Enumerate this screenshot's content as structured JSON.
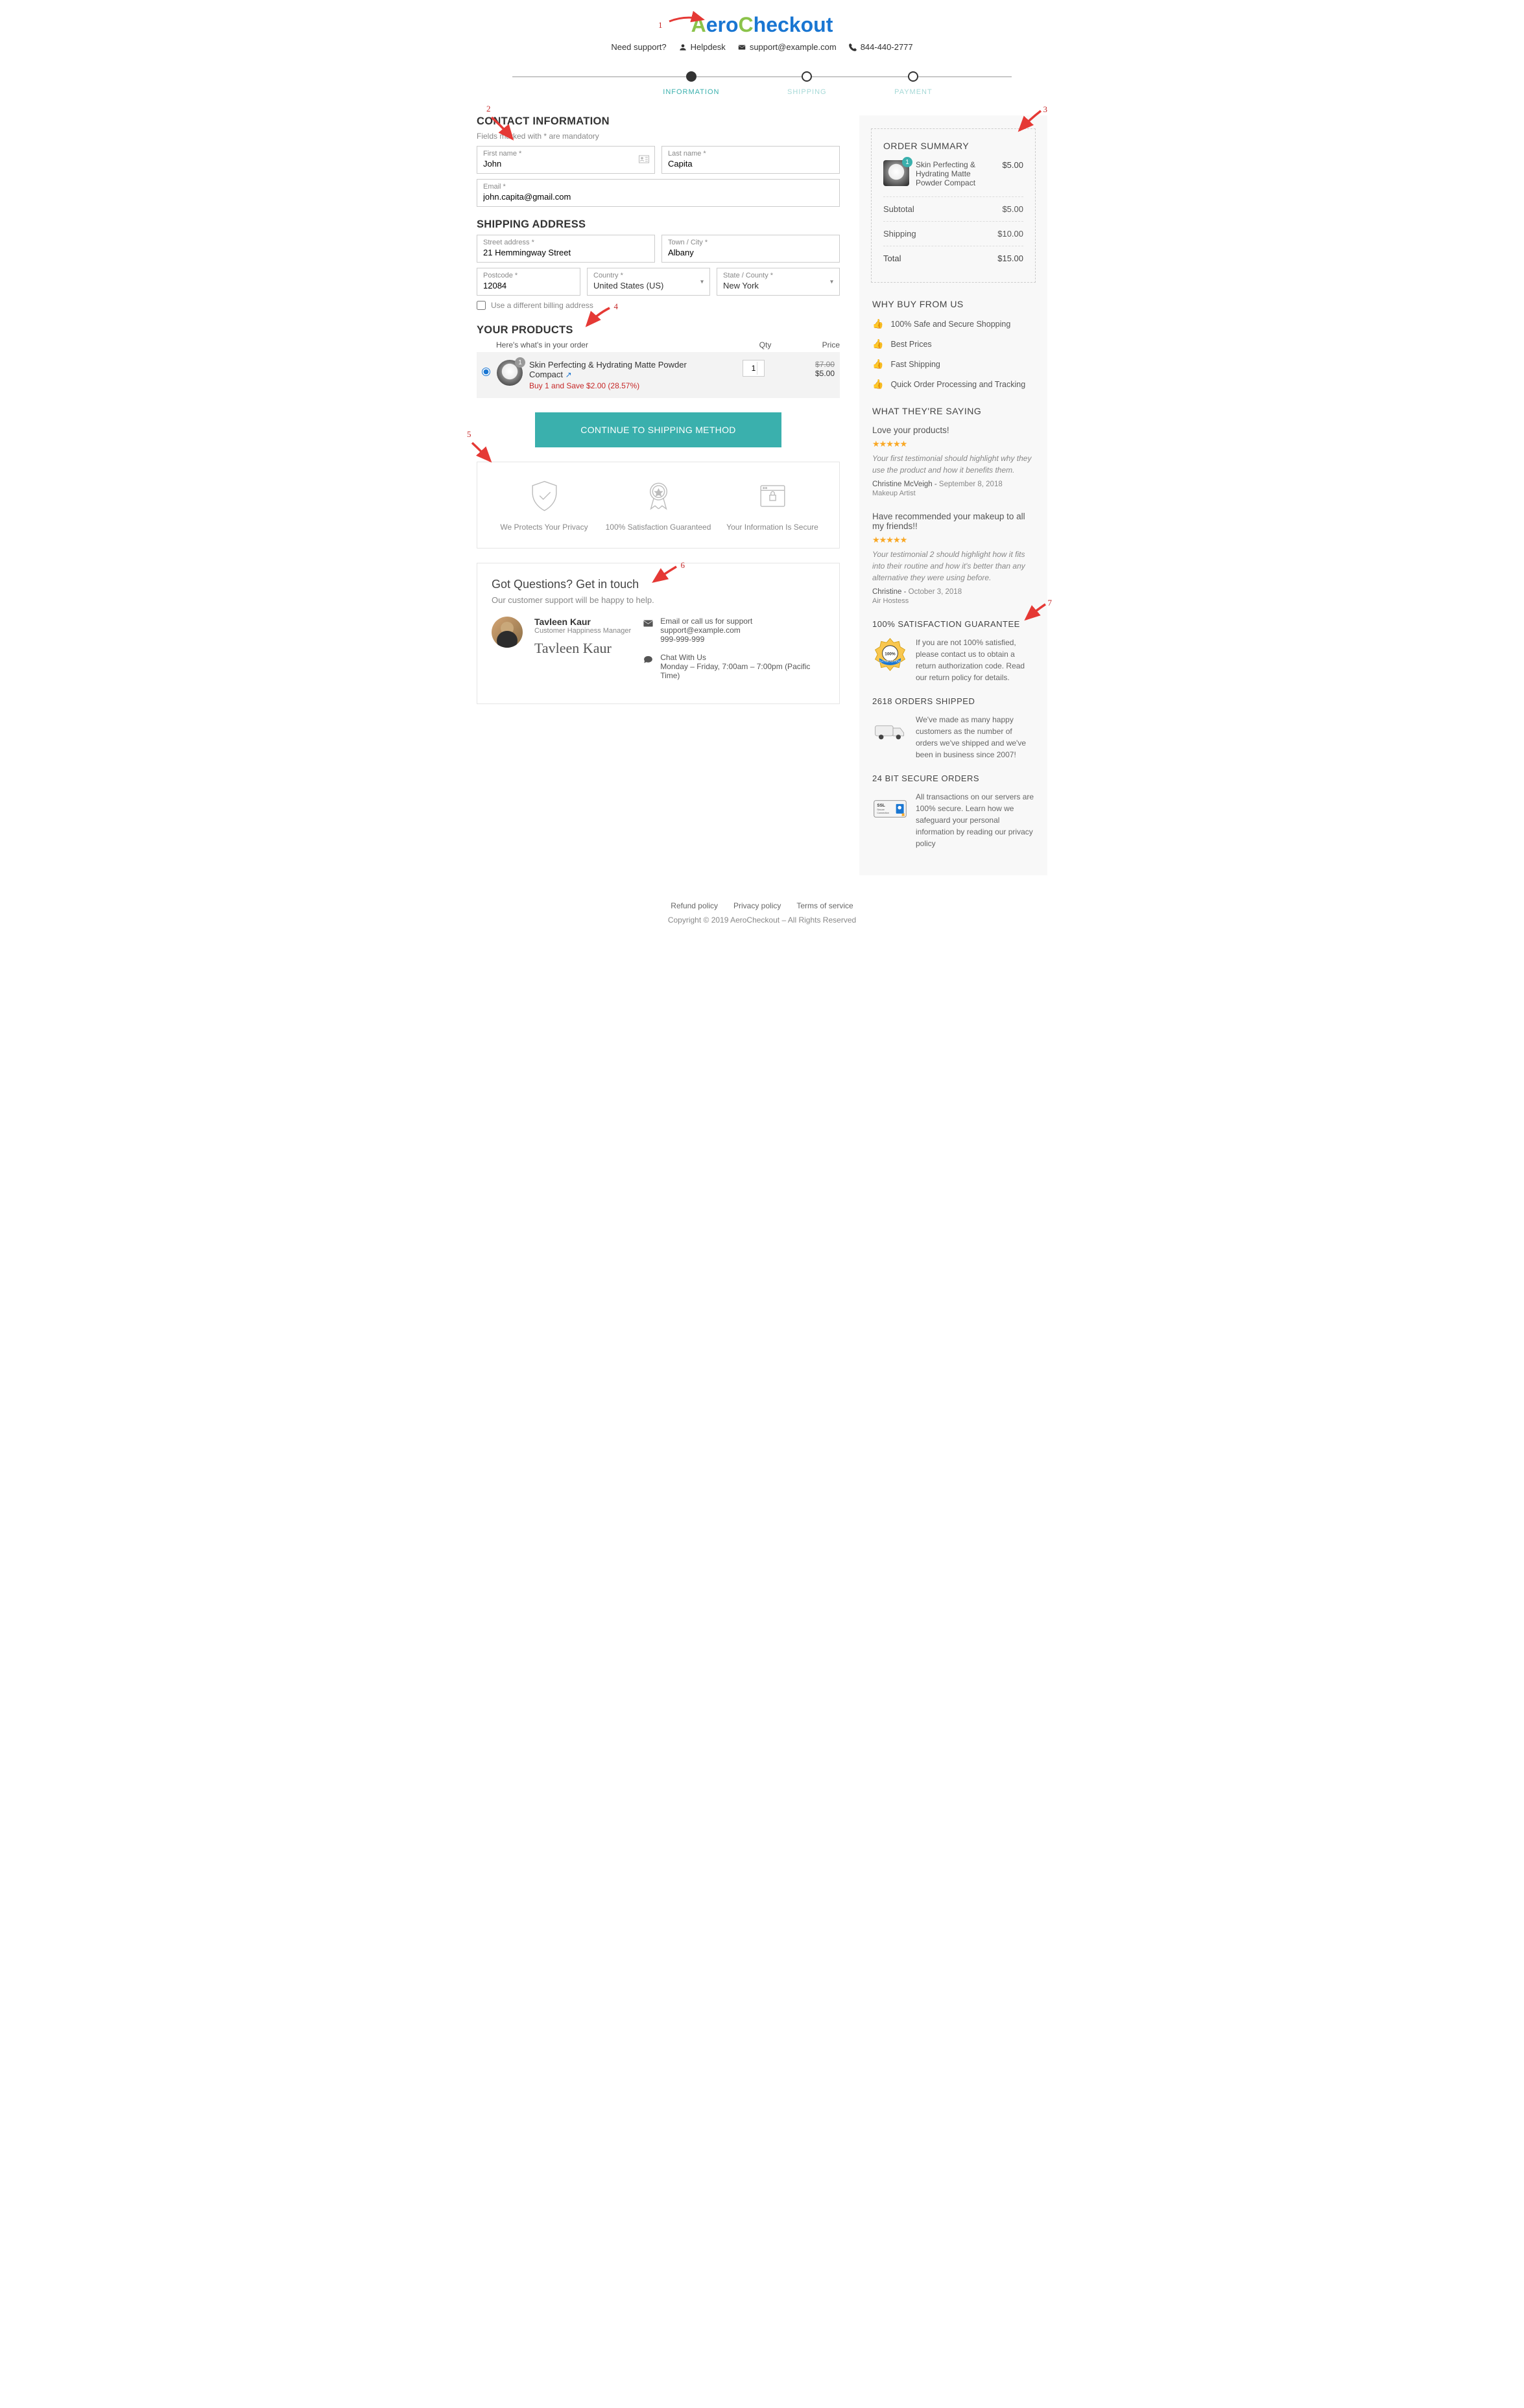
{
  "header": {
    "need": "Need support?",
    "helpdesk": "Helpdesk",
    "email": "support@example.com",
    "phone": "844-440-2777"
  },
  "steps": [
    "INFORMATION",
    "SHIPPING",
    "PAYMENT"
  ],
  "contact": {
    "heading": "CONTACT INFORMATION",
    "hint": "Fields marked with * are mandatory",
    "fn_l": "First name *",
    "fn": "John",
    "ln_l": "Last name *",
    "ln": "Capita",
    "em_l": "Email *",
    "em": "john.capita@gmail.com"
  },
  "ship": {
    "heading": "SHIPPING ADDRESS",
    "st_l": "Street address *",
    "st": "21 Hemmingway Street",
    "tc_l": "Town / City *",
    "tc": "Albany",
    "pc_l": "Postcode *",
    "pc": "12084",
    "co_l": "Country *",
    "co": "United States (US)",
    "sc_l": "State / County *",
    "sc": "New York",
    "diff": "Use a different billing address"
  },
  "prods": {
    "heading": "YOUR PRODUCTS",
    "sub": "Here's what's in your order",
    "h_qty": "Qty",
    "h_price": "Price",
    "name": "Skin Perfecting & Hydrating Matte Powder Compact",
    "deal": "Buy 1 and Save $2.00 (28.57%)",
    "qty": "1",
    "old": "$7.00",
    "new": "$5.00",
    "badge": "1"
  },
  "continue": "CONTINUE TO SHIPPING METHOD",
  "trust": [
    "We Protects Your Privacy",
    "100% Satisfaction Guaranteed",
    "Your Information Is Secure"
  ],
  "qbox": {
    "h": "Got Questions? Get in touch",
    "sub": "Our customer support will be happy to help.",
    "name": "Tavleen Kaur",
    "role": "Customer Happiness Manager",
    "sig": "Tavleen Kaur",
    "m1a": "Email or call us for support",
    "m1b": "support@example.com",
    "m1c": "999-999-999",
    "m2a": "Chat With Us",
    "m2b": "Monday – Friday, 7:00am – 7:00pm (Pacific Time)"
  },
  "order": {
    "h": "ORDER SUMMARY",
    "name": "Skin Perfecting & Hydrating Matte Powder Compact",
    "price": "$5.00",
    "badge": "1",
    "sub_l": "Subtotal",
    "sub": "$5.00",
    "ship_l": "Shipping",
    "ship": "$10.00",
    "tot_l": "Total",
    "tot": "$15.00"
  },
  "why": {
    "h": "WHY BUY FROM US",
    "items": [
      "100% Safe and Secure Shopping",
      "Best Prices",
      "Fast Shipping",
      "Quick Order Processing and Tracking"
    ]
  },
  "say": {
    "h": "WHAT THEY'RE SAYING",
    "t1": {
      "t": "Love your products!",
      "q": "Your first testimonial should highlight why they use the product and how it benefits them.",
      "by": "Christine McVeigh",
      "d": "September 8, 2018",
      "r": "Makeup Artist"
    },
    "t2": {
      "t": "Have recommended your makeup to all my friends!!",
      "q": "Your testimonial 2 should highlight how it fits into their routine and how it's better than any alternative they were using before.",
      "by": "Christine",
      "d": "October 3, 2018",
      "r": "Air Hostess"
    }
  },
  "g100": {
    "h": "100% SATISFACTION GUARANTEE",
    "t": "If you are not 100% satisfied, please contact us to obtain a return authorization code. Read our return policy for details."
  },
  "g2618": {
    "h": "2618 ORDERS SHIPPED",
    "t": "We've made as many happy customers as the number of orders we've shipped and we've been in business since 2007!"
  },
  "g24": {
    "h": "24 BIT SECURE ORDERS",
    "t": "All transactions on our servers are 100% secure. Learn how we safeguard your personal information by reading our privacy policy"
  },
  "footer": {
    "l1": "Refund policy",
    "l2": "Privacy policy",
    "l3": "Terms of service",
    "c": "Copyright © 2019 AeroCheckout – All Rights Reserved"
  },
  "annot": {
    "1": "1",
    "2": "2",
    "3": "3",
    "4": "4",
    "5": "5",
    "6": "6",
    "7": "7"
  }
}
